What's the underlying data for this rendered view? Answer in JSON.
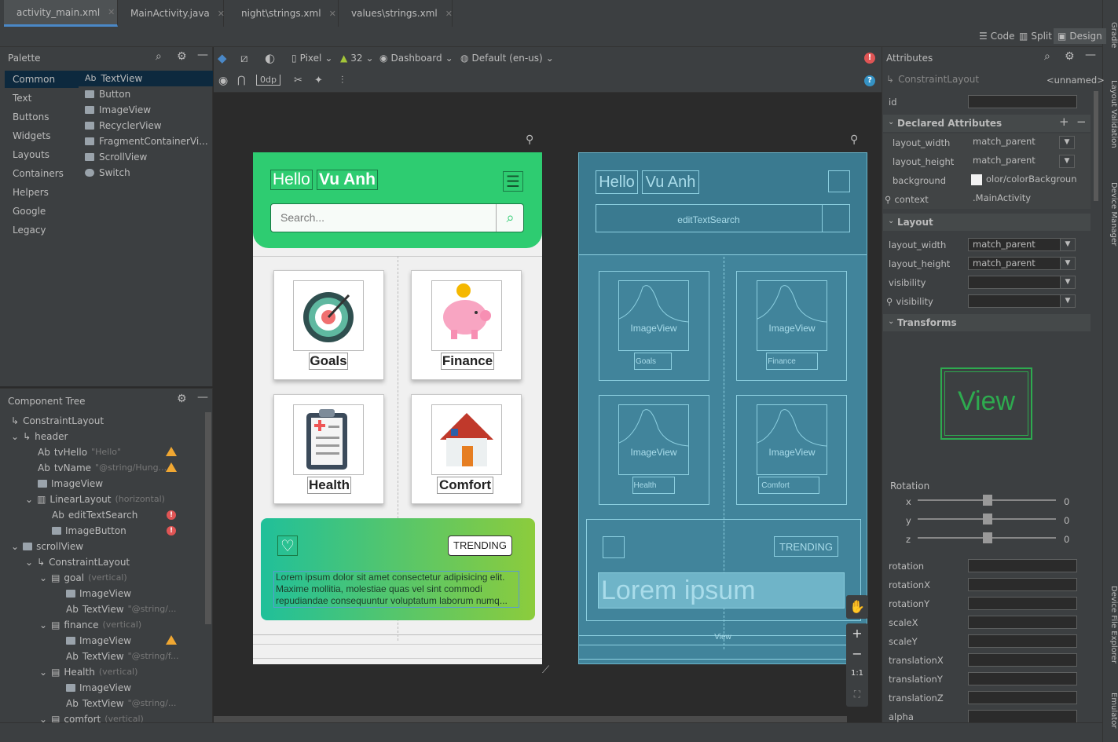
{
  "tabs": [
    {
      "label": "activity_main.xml",
      "active": true,
      "color": "#c75450"
    },
    {
      "label": "MainActivity.java",
      "active": false,
      "color": "#3592c4"
    },
    {
      "label": "night\\strings.xml",
      "active": false,
      "color": "#c75450"
    },
    {
      "label": "values\\strings.xml",
      "active": false,
      "color": "#c75450"
    }
  ],
  "right_strip": {
    "gradle": "Gradle",
    "layout_validation": "Layout Validation",
    "device_manager": "Device Manager",
    "device_file_explorer": "Device File Explorer",
    "emulator": "Emulator"
  },
  "view_modes": {
    "code": "Code",
    "split": "Split",
    "design": "Design"
  },
  "palette": {
    "title": "Palette",
    "categories": [
      "Common",
      "Text",
      "Buttons",
      "Widgets",
      "Layouts",
      "Containers",
      "Helpers",
      "Google",
      "Legacy"
    ],
    "items": [
      "TextView",
      "Button",
      "ImageView",
      "RecyclerView",
      "FragmentContainerVi...",
      "ScrollView",
      "Switch"
    ],
    "textview_prefix": "Ab"
  },
  "toolbar": {
    "device": "Pixel",
    "api": "32",
    "theme": "Dashboard",
    "locale": "Default (en-us)",
    "margin": "0dp"
  },
  "component_tree": {
    "title": "Component Tree",
    "rows": [
      {
        "label": "ConstraintLayout",
        "sub": ""
      },
      {
        "label": "header",
        "sub": ""
      },
      {
        "label": "tvHello",
        "sub": "\"Hello\"",
        "prefix": "Ab"
      },
      {
        "label": "tvName",
        "sub": "\"@string/Hung...",
        "prefix": "Ab"
      },
      {
        "label": "ImageView",
        "sub": ""
      },
      {
        "label": "LinearLayout",
        "sub": "(horizontal)"
      },
      {
        "label": "editTextSearch",
        "sub": "",
        "prefix": "Ab"
      },
      {
        "label": "ImageButton",
        "sub": ""
      },
      {
        "label": "scrollView",
        "sub": ""
      },
      {
        "label": "ConstraintLayout",
        "sub": ""
      },
      {
        "label": "goal",
        "sub": "(vertical)"
      },
      {
        "label": "ImageView",
        "sub": ""
      },
      {
        "label": "TextView",
        "sub": "\"@string/...",
        "prefix": "Ab"
      },
      {
        "label": "finance",
        "sub": "(vertical)"
      },
      {
        "label": "ImageView",
        "sub": ""
      },
      {
        "label": "TextView",
        "sub": "\"@string/f...",
        "prefix": "Ab"
      },
      {
        "label": "Health",
        "sub": "(vertical)"
      },
      {
        "label": "ImageView",
        "sub": ""
      },
      {
        "label": "TextView",
        "sub": "\"@string/...",
        "prefix": "Ab"
      },
      {
        "label": "comfort",
        "sub": "(vertical)"
      }
    ]
  },
  "phone": {
    "hello": "Hello",
    "name": "Vu Anh",
    "search_placeholder": "Search...",
    "cards": [
      "Goals",
      "Finance",
      "Health",
      "Comfort"
    ],
    "trending": "TRENDING",
    "lorem": "Lorem ipsum dolor sit amet consectetur adipisicing elit. Maxime mollitia, molestiae quas vel sint commodi repudiandae consequuntur voluptatum laborum numq..."
  },
  "blueprint": {
    "hello": "Hello",
    "name": "Vu Anh",
    "edit": "editTextSearch",
    "imageview": "ImageView",
    "cards": [
      "Goals",
      "Finance",
      "Health",
      "Comfort"
    ],
    "trending": "TRENDING",
    "lorem": "Lorem ipsum",
    "view": "View"
  },
  "zoom": {
    "ratio": "1:1"
  },
  "attributes": {
    "title": "Attributes",
    "component": "ConstraintLayout",
    "unnamed": "<unnamed>",
    "id_label": "id",
    "declared_title": "Declared Attributes",
    "declared": [
      {
        "name": "layout_width",
        "value": "match_parent"
      },
      {
        "name": "layout_height",
        "value": "match_parent"
      },
      {
        "name": "background",
        "value": "olor/colorBackground"
      },
      {
        "name": "context",
        "value": ".MainActivity"
      }
    ],
    "layout_title": "Layout",
    "layout": [
      {
        "name": "layout_width",
        "value": "match_parent"
      },
      {
        "name": "layout_height",
        "value": "match_parent"
      },
      {
        "name": "visibility",
        "value": ""
      },
      {
        "name": "visibility",
        "value": ""
      }
    ],
    "transforms_title": "Transforms",
    "view_preview": "View",
    "rotation_title": "Rotation",
    "rotation_axes": [
      {
        "axis": "x",
        "value": "0"
      },
      {
        "axis": "y",
        "value": "0"
      },
      {
        "axis": "z",
        "value": "0"
      }
    ],
    "fields": [
      "rotation",
      "rotationX",
      "rotationY",
      "scaleX",
      "scaleY",
      "translationX",
      "translationY",
      "translationZ",
      "alpha"
    ]
  }
}
